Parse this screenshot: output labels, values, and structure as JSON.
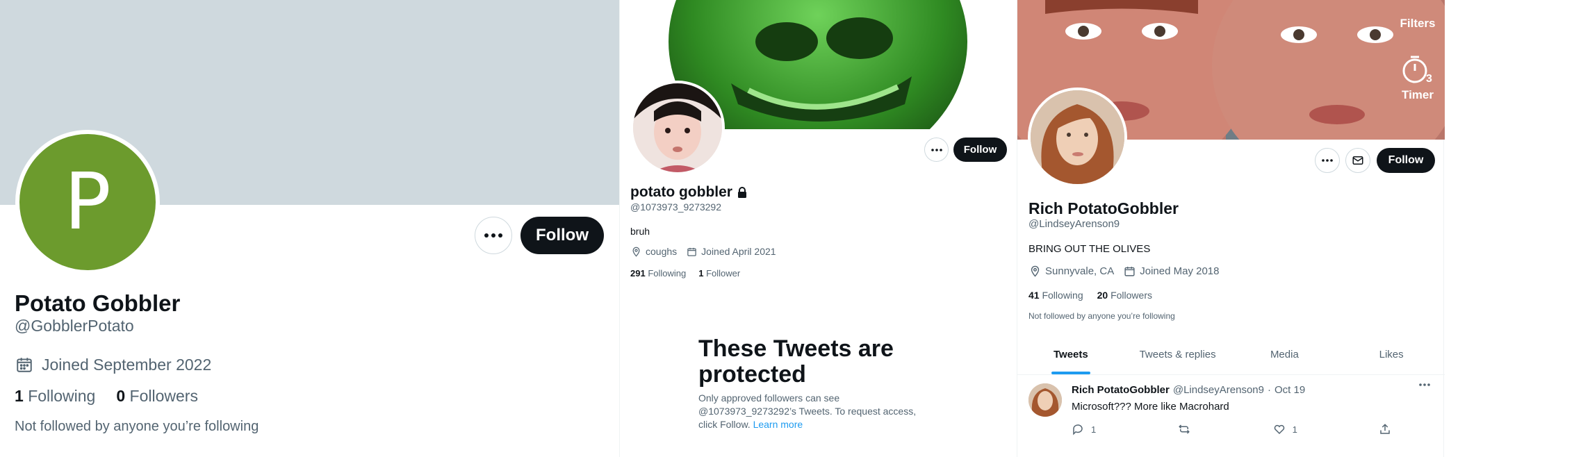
{
  "colors": {
    "text": "#0f1419",
    "muted": "#536471",
    "accent": "#1d9bf0",
    "button_dark": "#0f1419",
    "avatar_green": "#6c9b2d"
  },
  "panel1": {
    "avatar_letter": "P",
    "follow_label": "Follow",
    "display_name": "Potato Gobbler",
    "handle": "@GobblerPotato",
    "joined": "Joined September 2022",
    "following_count": "1",
    "following_label": "Following",
    "followers_count": "0",
    "followers_label": "Followers",
    "not_followed": "Not followed by anyone you’re following"
  },
  "panel2": {
    "follow_label": "Follow",
    "display_name": "potato gobbler",
    "handle": "@1073973_9273292",
    "bio": "bruh",
    "location": "coughs",
    "joined": "Joined April 2021",
    "following_count": "291",
    "following_label": "Following",
    "followers_count": "1",
    "followers_label": "Follower",
    "protected_title": "These Tweets are protected",
    "protected_body": "Only approved followers can see @1073973_9273292’s Tweets. To request access, click Follow.",
    "learn_more": "Learn more"
  },
  "panel3": {
    "overlay_filters": "Filters",
    "overlay_timer": "Timer",
    "follow_label": "Follow",
    "display_name": "Rich PotatoGobbler",
    "handle": "@LindseyArenson9",
    "bio": "BRING OUT THE OLIVES",
    "location": "Sunnyvale, CA",
    "joined": "Joined May 2018",
    "following_count": "41",
    "following_label": "Following",
    "followers_count": "20",
    "followers_label": "Followers",
    "not_followed": "Not followed by anyone you’re following",
    "tabs": [
      "Tweets",
      "Tweets & replies",
      "Media",
      "Likes"
    ],
    "tweet": {
      "name": "Rich PotatoGobbler",
      "handle": "@LindseyArenson9",
      "separator": "·",
      "date": "Oct 19",
      "text": "Microsoft??? More like Macrohard",
      "reply_count": "1",
      "like_count": "1"
    }
  }
}
